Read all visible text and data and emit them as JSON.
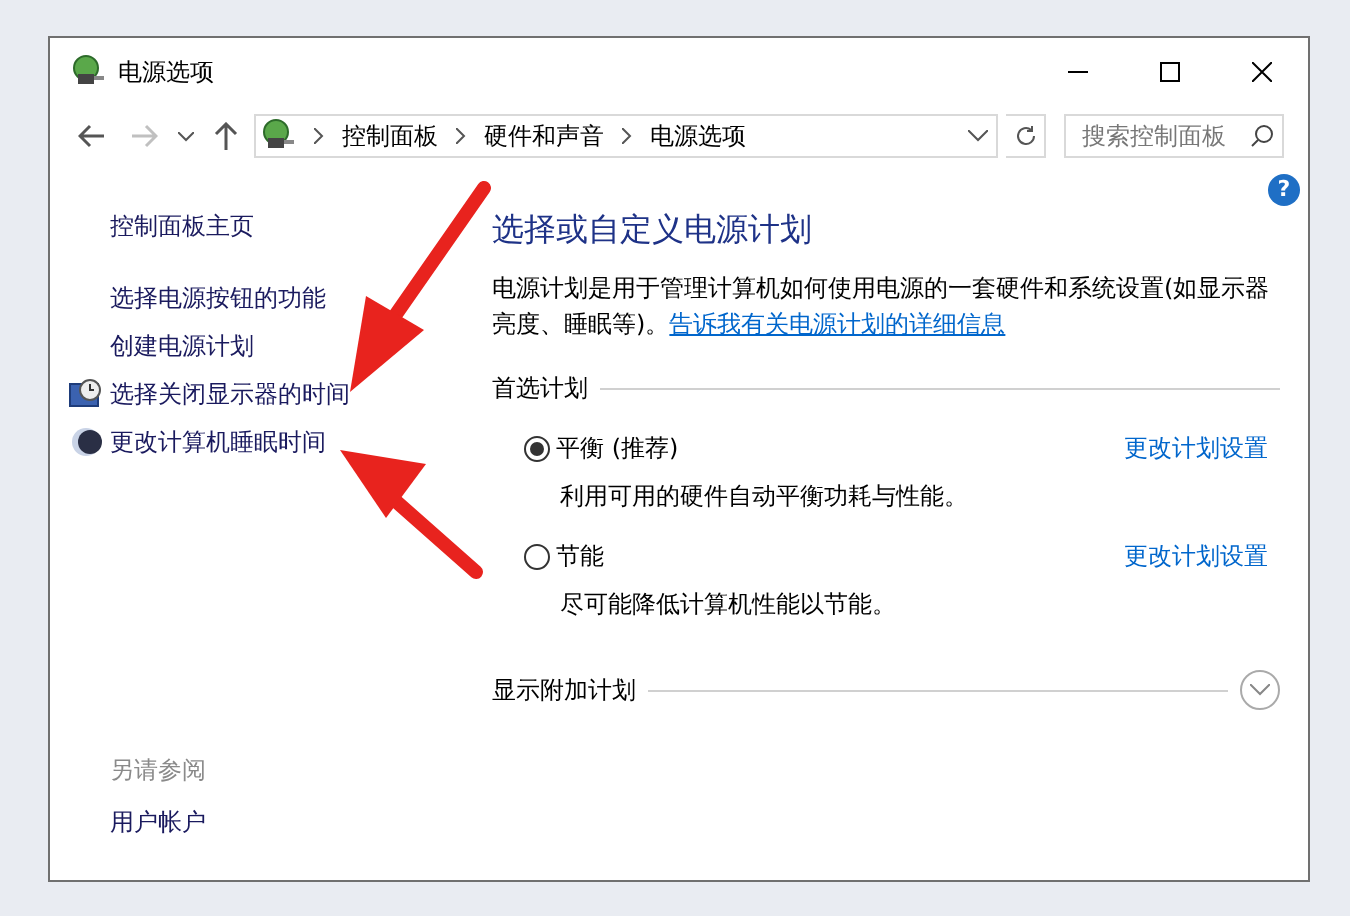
{
  "window": {
    "title": "电源选项"
  },
  "address_bar": {
    "crumbs": [
      "控制面板",
      "硬件和声音",
      "电源选项"
    ]
  },
  "search": {
    "placeholder": "搜索控制面板"
  },
  "help": {
    "glyph": "?"
  },
  "sidebar": {
    "items": [
      {
        "label": "控制面板主页",
        "kind": "home"
      },
      {
        "label": "选择电源按钮的功能",
        "kind": "link"
      },
      {
        "label": "创建电源计划",
        "kind": "link"
      },
      {
        "label": "选择关闭显示器的时间",
        "kind": "monitor"
      },
      {
        "label": "更改计算机睡眠时间",
        "kind": "sleep"
      }
    ],
    "see_also": {
      "heading": "另请参阅",
      "items": [
        "用户帐户"
      ]
    }
  },
  "main": {
    "title": "选择或自定义电源计划",
    "description": "电源计划是用于管理计算机如何使用电源的一套硬件和系统设置(如显示器亮度、睡眠等)。",
    "description_link": "告诉我有关电源计划的详细信息",
    "preferred_heading": "首选计划",
    "plans": [
      {
        "name": "平衡 (推荐)",
        "detail": "利用可用的硬件自动平衡功耗与性能。",
        "action": "更改计划设置",
        "selected": true
      },
      {
        "name": "节能",
        "detail": "尽可能降低计算机性能以节能。",
        "action": "更改计划设置",
        "selected": false
      }
    ],
    "additional": {
      "label": "显示附加计划",
      "expanded": false
    }
  }
}
